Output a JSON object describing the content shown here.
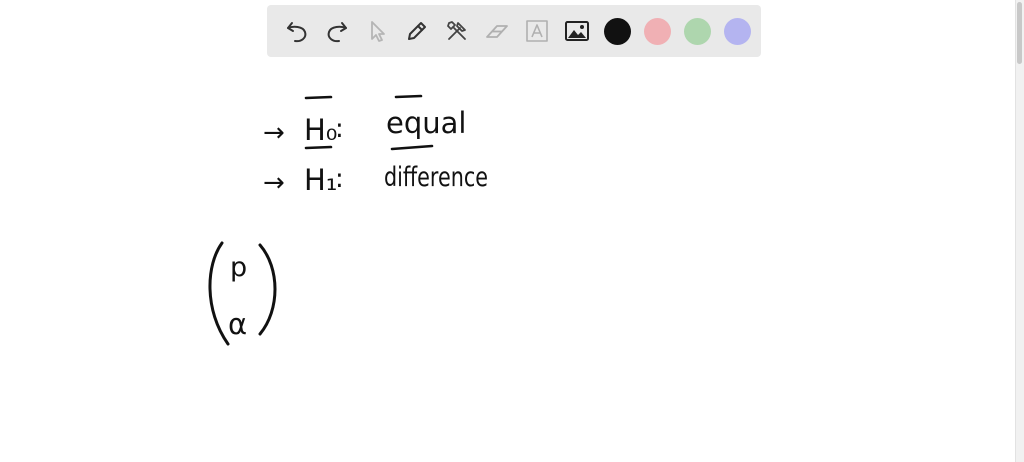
{
  "toolbar": {
    "tools": [
      {
        "name": "undo",
        "icon": "undo-icon"
      },
      {
        "name": "redo",
        "icon": "redo-icon"
      },
      {
        "name": "select",
        "icon": "pointer-icon",
        "disabled": true
      },
      {
        "name": "pen",
        "icon": "pencil-icon"
      },
      {
        "name": "tools",
        "icon": "tools-icon"
      },
      {
        "name": "eraser",
        "icon": "eraser-icon"
      },
      {
        "name": "text",
        "icon": "text-icon"
      },
      {
        "name": "image",
        "icon": "image-icon"
      }
    ],
    "colors": [
      "#111111",
      "#f0b0b4",
      "#aed6ae",
      "#b4b4f0"
    ]
  },
  "canvas": {
    "line1": {
      "arrow": "→",
      "label": "H₀",
      "colon": ":",
      "value": "equal"
    },
    "line2": {
      "arrow": "→",
      "label": "H₁",
      "colon": ":",
      "value": "difference"
    },
    "bracket_top": "p",
    "bracket_bottom": "α"
  }
}
